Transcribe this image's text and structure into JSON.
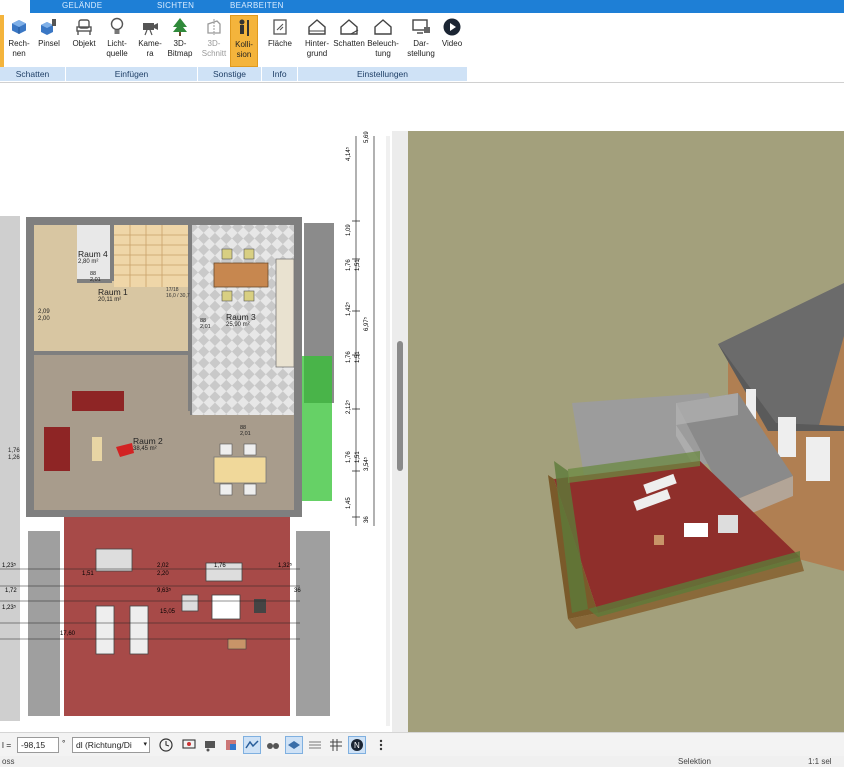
{
  "ribbon": {
    "tabs": [
      "GELÄNDE",
      "SICHTEN",
      "BEARBEITEN"
    ],
    "buttons": {
      "rechnen": "Rech-\nnen",
      "pinsel": "Pinsel",
      "objekt": "Objekt",
      "lichtquelle": "Licht-\nquelle",
      "kamera": "Kame-\nra",
      "bitmap3d": "3D-\nBitmap",
      "schnitt3d": "3D-\nSchnitt",
      "kollision": "Kolli-\nsion",
      "flaeche": "Fläche",
      "hintergrund": "Hinter-\ngrund",
      "schatten": "Schatten",
      "beleuchtung": "Beleuch-\ntung",
      "darstellung": "Dar-\nstellung",
      "video": "Video"
    },
    "groups": {
      "schatten": "Schatten",
      "einfuegen": "Einfügen",
      "sonstige": "Sonstige",
      "info": "Info",
      "einstellungen": "Einstellungen"
    }
  },
  "plan": {
    "rooms": [
      {
        "name": "Raum 4",
        "area": "2,80 m²"
      },
      {
        "name": "Raum 1",
        "area": "20,11 m²"
      },
      {
        "name": "Raum 3",
        "area": "25,90 m²"
      },
      {
        "name": "Raum 2",
        "area": "38,45 m²"
      }
    ],
    "stair_label": "17/18\n16,0 / 30,7",
    "dims_right": [
      "5,69",
      "4,14⁵",
      "1,09",
      "1,76",
      "1,51",
      "6,97⁵",
      "1,42⁵",
      "1,76",
      "1,51",
      "2,12⁵",
      "3,54⁵",
      "1,76",
      "1,51",
      "1,45",
      "36"
    ],
    "dims_bottom": [
      "1,23⁵",
      "2,02",
      "1,76",
      "1,32⁵",
      "1,51",
      "2,20",
      "1,72",
      "9,63⁵",
      "36",
      "1,23⁵",
      "17,60",
      "15,05"
    ],
    "misc_labels": [
      "2,09",
      "2,00",
      "88",
      "2,01",
      "88",
      "2,01",
      "1,76",
      "1,26",
      "88",
      "2,01"
    ]
  },
  "toolbar": {
    "angle_label": "l =",
    "angle_value": "-98,15",
    "angle_unit": "°",
    "direction_select": "dl (Richtung/Di"
  },
  "status": {
    "left": "oss",
    "center": "Selektion",
    "right": "1:1 sel"
  },
  "colors": {
    "ribbon_blue": "#1e7fd6",
    "group_bar": "#cfe2f6",
    "active_button": "#f4b43c",
    "lawn": "#a3a07c",
    "terrace_red": "#8f2f2b",
    "floor_tan": "#d9c7a3",
    "room_gray": "#a89c8c"
  }
}
